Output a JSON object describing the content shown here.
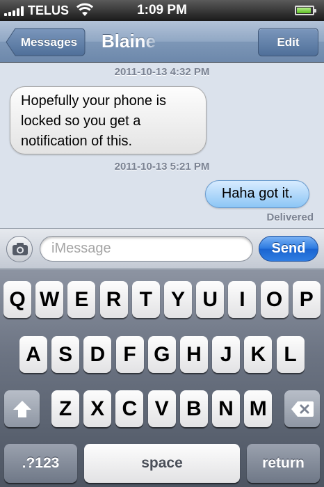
{
  "status_bar": {
    "carrier": "TELUS",
    "time": "1:09 PM",
    "signal_bars": 5,
    "wifi_icon": "wifi-icon",
    "battery_level": 0.9,
    "battery_color": "#5bbd23"
  },
  "nav": {
    "back_label": "Messages",
    "title": "Blaine",
    "edit_label": "Edit",
    "bar_color": "#7d97b7"
  },
  "conversation": {
    "messages": [
      {
        "timestamp": "2011-10-13 4:32 PM",
        "direction": "incoming",
        "text_lines": [
          "Hopefully your phone is",
          "locked so you get a",
          "notification of this."
        ]
      },
      {
        "timestamp": "2011-10-13 5:21 PM",
        "direction": "outgoing",
        "text_lines": [
          "Haha got it."
        ]
      }
    ],
    "status": "Delivered"
  },
  "compose": {
    "camera_icon": "camera-icon",
    "placeholder": "iMessage",
    "value": "",
    "send_label": "Send",
    "send_color": "#2a78e0"
  },
  "keyboard": {
    "row1": [
      "Q",
      "W",
      "E",
      "R",
      "T",
      "Y",
      "U",
      "I",
      "O",
      "P"
    ],
    "row2": [
      "A",
      "S",
      "D",
      "F",
      "G",
      "H",
      "J",
      "K",
      "L"
    ],
    "row3": [
      "Z",
      "X",
      "C",
      "V",
      "B",
      "N",
      "M"
    ],
    "shift_icon": "shift-icon",
    "backspace_icon": "backspace-icon",
    "numbers_label": ".?123",
    "space_label": "space",
    "return_label": "return"
  }
}
